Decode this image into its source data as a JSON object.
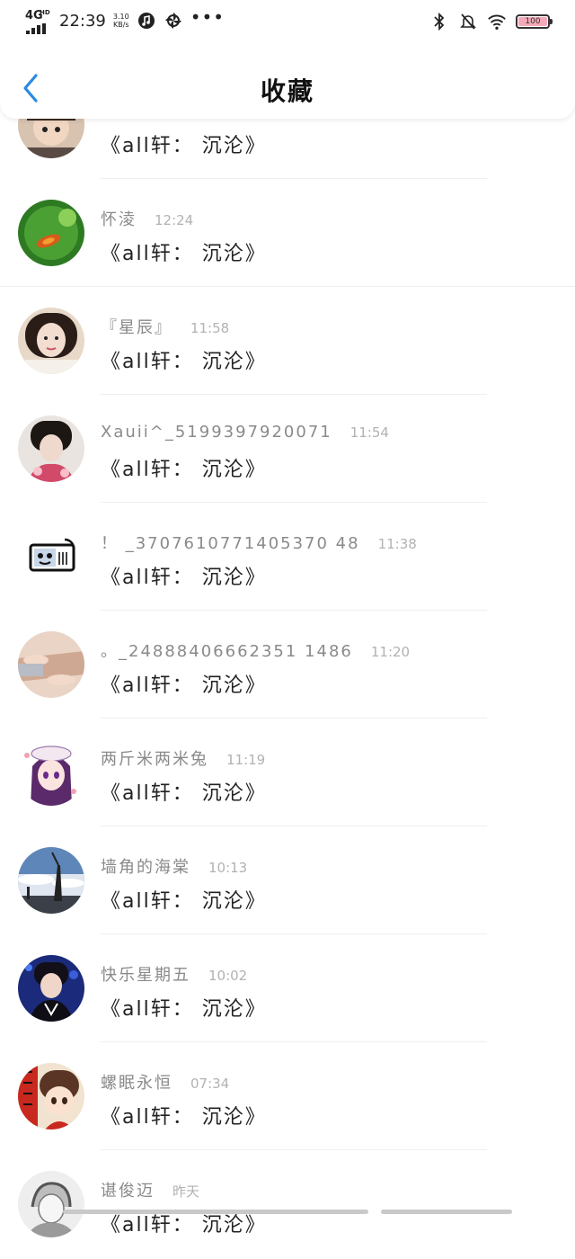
{
  "status": {
    "network": "4G",
    "hd": "HD",
    "time": "22:39",
    "speed_value": "3.10",
    "speed_unit": "KB/s",
    "battery": "100"
  },
  "header": {
    "title": "收藏"
  },
  "items": [
    {
      "name": "",
      "time": "",
      "content": "《all轩： 沉沦》",
      "avatar": "child"
    },
    {
      "name": "怀淩",
      "time": "12:24",
      "content": "《all轩： 沉沦》",
      "avatar": "leaf"
    },
    {
      "name": "『星辰』",
      "time": "11:58",
      "content": "《all轩： 沉沦》",
      "avatar": "girl"
    },
    {
      "name": "Xauii^_5199397920071",
      "time": "11:54",
      "content": "《all轩： 沉沦》",
      "avatar": "boy"
    },
    {
      "name": "！ _3707610771405370 48",
      "time": "11:38",
      "content": "《all轩： 沉沦》",
      "avatar": "robot"
    },
    {
      "name": "。_24888406662351 1486",
      "time": "11:20",
      "content": "《all轩： 沉沦》",
      "avatar": "hands"
    },
    {
      "name": "两斤米两米兔",
      "time": "11:19",
      "content": "《all轩： 沉沦》",
      "avatar": "anime"
    },
    {
      "name": "墙角的海棠",
      "time": "10:13",
      "content": "《all轩： 沉沦》",
      "avatar": "sky"
    },
    {
      "name": "快乐星期五",
      "time": "10:02",
      "content": "《all轩： 沉沦》",
      "avatar": "singer"
    },
    {
      "name": "螺眠永恒",
      "time": "07:34",
      "content": "《all轩： 沉沦》",
      "avatar": "cartoon"
    },
    {
      "name": "谌俊迈",
      "time": "昨天",
      "content": "《all轩： 沉沦》",
      "avatar": "sketch"
    }
  ]
}
